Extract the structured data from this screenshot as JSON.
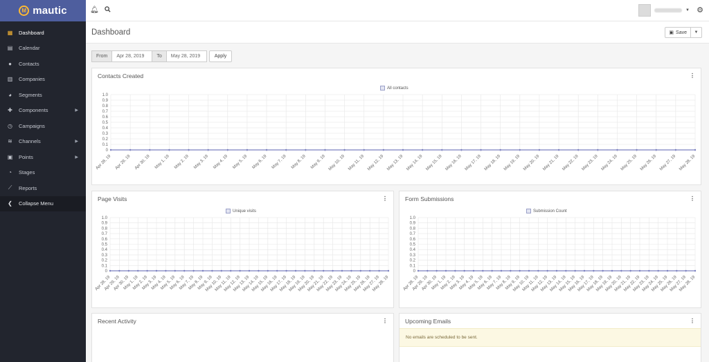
{
  "app": {
    "logo_text": "mautic",
    "logo_mark": "M"
  },
  "sidebar": {
    "items": [
      {
        "label": "Dashboard",
        "icon": "dashboard-icon",
        "glyph": "▦",
        "active": true
      },
      {
        "label": "Calendar",
        "icon": "calendar-icon",
        "glyph": "▤"
      },
      {
        "label": "Contacts",
        "icon": "user-icon",
        "glyph": "●"
      },
      {
        "label": "Companies",
        "icon": "building-icon",
        "glyph": "▥"
      },
      {
        "label": "Segments",
        "icon": "pie-chart-icon",
        "glyph": "◕"
      },
      {
        "label": "Components",
        "icon": "puzzle-icon",
        "glyph": "✚",
        "submenu": true
      },
      {
        "label": "Campaigns",
        "icon": "clock-icon",
        "glyph": "◷"
      },
      {
        "label": "Channels",
        "icon": "rss-icon",
        "glyph": "≋",
        "submenu": true
      },
      {
        "label": "Points",
        "icon": "calculator-icon",
        "glyph": "▣",
        "submenu": true
      },
      {
        "label": "Stages",
        "icon": "tachometer-icon",
        "glyph": "◔"
      },
      {
        "label": "Reports",
        "icon": "line-chart-icon",
        "glyph": "⟋"
      }
    ],
    "collapse_label": "Collapse Menu"
  },
  "topbar": {
    "bell_icon": "bell-icon",
    "search_icon": "search-icon",
    "settings_icon": "gear-icon"
  },
  "header": {
    "title": "Dashboard",
    "save_label": "Save"
  },
  "filter": {
    "from_label": "From",
    "from_value": "Apr 28, 2019",
    "to_label": "To",
    "to_value": "May 28, 2019",
    "apply_label": "Apply"
  },
  "panels": {
    "contacts_created": {
      "title": "Contacts Created"
    },
    "page_visits": {
      "title": "Page Visits"
    },
    "form_submissions": {
      "title": "Form Submissions"
    },
    "recent_activity": {
      "title": "Recent Activity"
    },
    "upcoming_emails": {
      "title": "Upcoming Emails",
      "empty_message": "No emails are scheduled to be sent."
    }
  },
  "chart_data": [
    {
      "type": "line",
      "title": "Contacts Created",
      "legend": "All contacts",
      "legend_position": "top",
      "x": [
        "Apr 28, 19",
        "Apr 29, 19",
        "Apr 30, 19",
        "May 1, 19",
        "May 2, 19",
        "May 3, 19",
        "May 4, 19",
        "May 5, 19",
        "May 6, 19",
        "May 7, 19",
        "May 8, 19",
        "May 9, 19",
        "May 10, 19",
        "May 11, 19",
        "May 12, 19",
        "May 13, 19",
        "May 14, 19",
        "May 15, 19",
        "May 16, 19",
        "May 17, 19",
        "May 18, 19",
        "May 19, 19",
        "May 20, 19",
        "May 21, 19",
        "May 22, 19",
        "May 23, 19",
        "May 24, 19",
        "May 25, 19",
        "May 26, 19",
        "May 27, 19",
        "May 28, 19"
      ],
      "series": [
        {
          "name": "All contacts",
          "values": [
            0,
            0,
            0,
            0,
            0,
            0,
            0,
            0,
            0,
            0,
            0,
            0,
            0,
            0,
            0,
            0,
            0,
            0,
            0,
            0,
            0,
            0,
            0,
            0,
            0,
            0,
            0,
            0,
            0,
            0,
            0
          ]
        }
      ],
      "ylim": [
        0,
        1
      ],
      "yticks": [
        "1.0",
        "0.9",
        "0.8",
        "0.7",
        "0.6",
        "0.5",
        "0.4",
        "0.3",
        "0.2",
        "0.1",
        "0"
      ],
      "grid": true,
      "color": "#7a7fbf"
    },
    {
      "type": "line",
      "title": "Page Visits",
      "legend": "Unique visits",
      "legend_position": "top",
      "x": [
        "Apr 28, 19",
        "Apr 29, 19",
        "Apr 30, 19",
        "May 1, 19",
        "May 2, 19",
        "May 3, 19",
        "May 4, 19",
        "May 5, 19",
        "May 6, 19",
        "May 7, 19",
        "May 8, 19",
        "May 9, 19",
        "May 10, 19",
        "May 11, 19",
        "May 12, 19",
        "May 13, 19",
        "May 14, 19",
        "May 15, 19",
        "May 16, 19",
        "May 17, 19",
        "May 18, 19",
        "May 19, 19",
        "May 20, 19",
        "May 21, 19",
        "May 22, 19",
        "May 23, 19",
        "May 24, 19",
        "May 25, 19",
        "May 26, 19",
        "May 27, 19",
        "May 28, 19"
      ],
      "series": [
        {
          "name": "Unique visits",
          "values": [
            0,
            0,
            0,
            0,
            0,
            0,
            0,
            0,
            0,
            0,
            0,
            0,
            0,
            0,
            0,
            0,
            0,
            0,
            0,
            0,
            0,
            0,
            0,
            0,
            0,
            0,
            0,
            0,
            0,
            0,
            0
          ]
        }
      ],
      "ylim": [
        0,
        1
      ],
      "yticks": [
        "1.0",
        "0.9",
        "0.8",
        "0.7",
        "0.6",
        "0.5",
        "0.4",
        "0.3",
        "0.2",
        "0.1",
        "0"
      ],
      "grid": true,
      "color": "#7a7fbf"
    },
    {
      "type": "line",
      "title": "Form Submissions",
      "legend": "Submission Count",
      "legend_position": "top",
      "x": [
        "Apr 28, 19",
        "Apr 29, 19",
        "Apr 30, 19",
        "May 1, 19",
        "May 2, 19",
        "May 3, 19",
        "May 4, 19",
        "May 5, 19",
        "May 6, 19",
        "May 7, 19",
        "May 8, 19",
        "May 9, 19",
        "May 10, 19",
        "May 11, 19",
        "May 12, 19",
        "May 13, 19",
        "May 14, 19",
        "May 15, 19",
        "May 16, 19",
        "May 17, 19",
        "May 18, 19",
        "May 19, 19",
        "May 20, 19",
        "May 21, 19",
        "May 22, 19",
        "May 23, 19",
        "May 24, 19",
        "May 25, 19",
        "May 26, 19",
        "May 27, 19",
        "May 28, 19"
      ],
      "series": [
        {
          "name": "Submission Count",
          "values": [
            0,
            0,
            0,
            0,
            0,
            0,
            0,
            0,
            0,
            0,
            0,
            0,
            0,
            0,
            0,
            0,
            0,
            0,
            0,
            0,
            0,
            0,
            0,
            0,
            0,
            0,
            0,
            0,
            0,
            0,
            0
          ]
        }
      ],
      "ylim": [
        0,
        1
      ],
      "yticks": [
        "1.0",
        "0.9",
        "0.8",
        "0.7",
        "0.6",
        "0.5",
        "0.4",
        "0.3",
        "0.2",
        "0.1",
        "0"
      ],
      "grid": true,
      "color": "#7a7fbf"
    }
  ]
}
